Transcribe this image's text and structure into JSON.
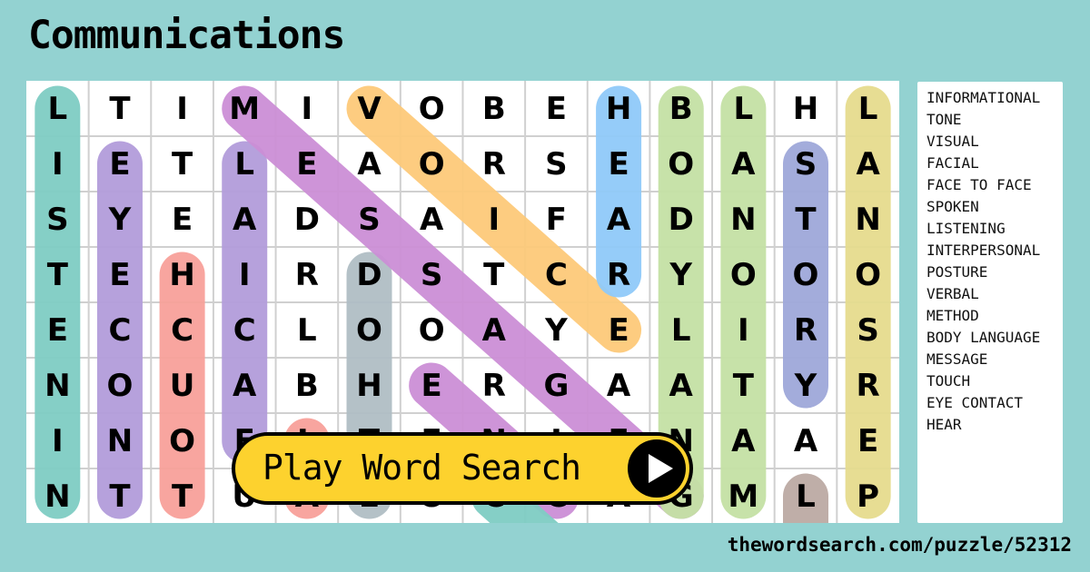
{
  "title": "Communications",
  "grid": {
    "rows": [
      [
        "L",
        "T",
        "I",
        "M",
        "I",
        "V",
        "O",
        "B",
        "E",
        "H",
        "B",
        "L",
        "H",
        "L"
      ],
      [
        "I",
        "E",
        "T",
        "L",
        "E",
        "A",
        "O",
        "R",
        "S",
        "E",
        "O",
        "A",
        "S",
        "A"
      ],
      [
        "S",
        "Y",
        "E",
        "A",
        "D",
        "S",
        "A",
        "I",
        "F",
        "A",
        "D",
        "N",
        "T",
        "N"
      ],
      [
        "T",
        "E",
        "H",
        "I",
        "R",
        "D",
        "S",
        "T",
        "C",
        "R",
        "Y",
        "O",
        "O",
        "O"
      ],
      [
        "E",
        "C",
        "C",
        "C",
        "L",
        "O",
        "O",
        "A",
        "Y",
        "E",
        "L",
        "I",
        "R",
        "S"
      ],
      [
        "N",
        "O",
        "U",
        "A",
        "B",
        "H",
        "E",
        "R",
        "G",
        "A",
        "A",
        "T",
        "Y",
        "R"
      ],
      [
        "I",
        "N",
        "O",
        "F",
        "L",
        "T",
        "E",
        "N",
        "I",
        "E",
        "N",
        "A",
        "A",
        "E"
      ],
      [
        "N",
        "T",
        "T",
        "U",
        "A",
        "E",
        "O",
        "C",
        "C",
        "A",
        "G",
        "M",
        "L",
        "P"
      ]
    ],
    "highlights": [
      {
        "from": [
          0,
          0
        ],
        "to": [
          7,
          0
        ],
        "color": "#7fcdc4"
      },
      {
        "from": [
          1,
          1
        ],
        "to": [
          7,
          1
        ],
        "color": "#b39ddb"
      },
      {
        "from": [
          3,
          2
        ],
        "to": [
          7,
          2
        ],
        "color": "#f8a19a"
      },
      {
        "from": [
          1,
          3
        ],
        "to": [
          6,
          3
        ],
        "color": "#b39ddb"
      },
      {
        "from": [
          6,
          4
        ],
        "to": [
          7,
          4
        ],
        "color": "#f8a19a"
      },
      {
        "from": [
          3,
          5
        ],
        "to": [
          7,
          5
        ],
        "color": "#b0bec5"
      },
      {
        "from": [
          0,
          3
        ],
        "to": [
          7,
          10
        ],
        "color": "#cc8fd6"
      },
      {
        "from": [
          0,
          5
        ],
        "to": [
          4,
          9
        ],
        "color": "#fdca7a"
      },
      {
        "from": [
          5,
          6
        ],
        "to": [
          7,
          8
        ],
        "color": "#cc8fd6"
      },
      {
        "from": [
          7,
          7
        ],
        "to": [
          8,
          8
        ],
        "color": "#7fcdc4"
      },
      {
        "from": [
          0,
          9
        ],
        "to": [
          3,
          9
        ],
        "color": "#90caf9"
      },
      {
        "from": [
          0,
          10
        ],
        "to": [
          7,
          10
        ],
        "color": "#c5e1a5"
      },
      {
        "from": [
          0,
          11
        ],
        "to": [
          7,
          11
        ],
        "color": "#c5e1a5"
      },
      {
        "from": [
          1,
          12
        ],
        "to": [
          5,
          12
        ],
        "color": "#9fa8da"
      },
      {
        "from": [
          7,
          12
        ],
        "to": [
          7,
          12
        ],
        "color": "#bcaaa4"
      },
      {
        "from": [
          0,
          13
        ],
        "to": [
          7,
          13
        ],
        "color": "#e6dc8e"
      }
    ]
  },
  "words": [
    "INFORMATIONAL",
    "TONE",
    "VISUAL",
    "FACIAL",
    "FACE TO FACE",
    "SPOKEN",
    "LISTENING",
    "INTERPERSONAL",
    "POSTURE",
    "VERBAL",
    "METHOD",
    "BODY LANGUAGE",
    "MESSAGE",
    "TOUCH",
    "EYE CONTACT",
    "HEAR"
  ],
  "play_button": {
    "label": "Play Word Search",
    "icon": "play-icon"
  },
  "footer": {
    "url": "thewordsearch.com/puzzle/52312"
  },
  "colors": {
    "background": "#93d2d1",
    "button": "#fdd22e"
  }
}
